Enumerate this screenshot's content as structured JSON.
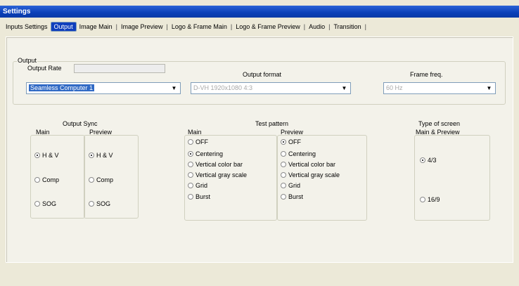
{
  "window": {
    "title": "Settings"
  },
  "tabs": [
    {
      "label": "Inputs Settings"
    },
    {
      "label": "Output"
    },
    {
      "label": "Image Main"
    },
    {
      "label": "Image Preview"
    },
    {
      "label": "Logo & Frame Main"
    },
    {
      "label": "Logo & Frame Preview"
    },
    {
      "label": "Audio"
    },
    {
      "label": "Transition"
    }
  ],
  "active_tab": "Output",
  "output": {
    "group_label": "Output",
    "output_rate_label": "Output Rate",
    "output_rate_value": "",
    "output_device": "Seamless Computer 1",
    "output_format_label": "Output format",
    "output_format_value": "D-VH     1920x1080   4:3",
    "frame_freq_label": "Frame freq.",
    "frame_freq_value": "60 Hz"
  },
  "output_sync": {
    "label": "Output Sync",
    "main": {
      "label": "Main",
      "options": [
        "H & V",
        "Comp",
        "SOG"
      ],
      "selected": "H & V"
    },
    "preview": {
      "label": "Preview",
      "options": [
        "H & V",
        "Comp",
        "SOG"
      ],
      "selected": "H & V"
    }
  },
  "test_pattern": {
    "label": "Test pattern",
    "main": {
      "label": "Main",
      "options": [
        "OFF",
        "Centering",
        "Vertical color bar",
        "Vertical gray scale",
        "Grid",
        "Burst"
      ],
      "selected": "Centering"
    },
    "preview": {
      "label": "Preview",
      "options": [
        "OFF",
        "Centering",
        "Vertical color bar",
        "Vertical gray scale",
        "Grid",
        "Burst"
      ],
      "selected": "OFF"
    }
  },
  "screen_type": {
    "label": "Type of screen",
    "sub_label": "Main & Preview",
    "options": [
      "4/3",
      "16/9"
    ],
    "selected": "4/3"
  }
}
